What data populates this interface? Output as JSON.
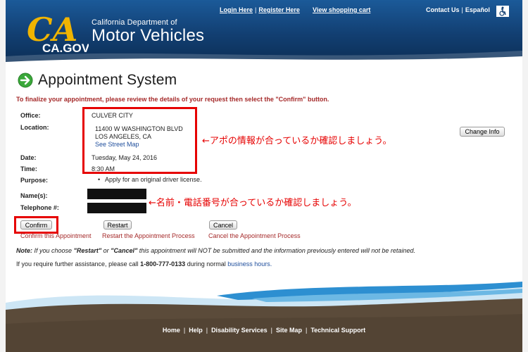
{
  "header": {
    "logo_text": "CA.GOV",
    "dept_small": "California Department of",
    "dept_big": "Motor Vehicles",
    "login": "Login Here",
    "register": "Register Here",
    "cart": "View shopping cart",
    "contact": "Contact Us",
    "espanol": "Español"
  },
  "page": {
    "title": "Appointment System",
    "instruction": "To finalize your appointment, please review the details of your request then select the \"Confirm\" button."
  },
  "details": {
    "office_label": "Office:",
    "office_value": "CULVER CITY",
    "location_label": "Location:",
    "address_line1": "11400 W WASHINGTON BLVD",
    "address_line2": "LOS ANGELES, CA",
    "street_map": "See Street Map",
    "change_info": "Change Info",
    "date_label": "Date:",
    "date_value": "Tuesday, May 24, 2016",
    "time_label": "Time:",
    "time_value": "8:30 AM",
    "purpose_label": "Purpose:",
    "purpose_value": "Apply for an original driver license.",
    "name_label": "Name(s):",
    "phone_label": "Telephone #:"
  },
  "annotations": {
    "note1": "←アポの情報が合っているか確認しましょう。",
    "note2": "←名前・電話番号が合っているか確認しましょう。"
  },
  "actions": {
    "confirm": "Confirm",
    "confirm_caption": "Confirm this Appointment",
    "restart": "Restart",
    "restart_caption": "Restart the Appointment Process",
    "cancel": "Cancel",
    "cancel_caption": "Cancel the Appointment Process"
  },
  "note": {
    "label": "Note:",
    "text_a": "If you choose",
    "restart_q": "\"Restart\"",
    "or": "or",
    "cancel_q": "\"Cancel\"",
    "text_b": "this appointment will NOT be submitted and the information previously entered will not be retained."
  },
  "help": {
    "text": "If you require further assistance, please call",
    "phone": "1-800-777-0133",
    "text2": "during normal",
    "hours_link": "business hours."
  },
  "footer": {
    "home": "Home",
    "help": "Help",
    "disability": "Disability Services",
    "sitemap": "Site Map",
    "tech": "Technical Support"
  },
  "colors": {
    "header_blue": "#123f72",
    "accent_red": "#e60000",
    "footer_brown": "#5b4b3a"
  }
}
